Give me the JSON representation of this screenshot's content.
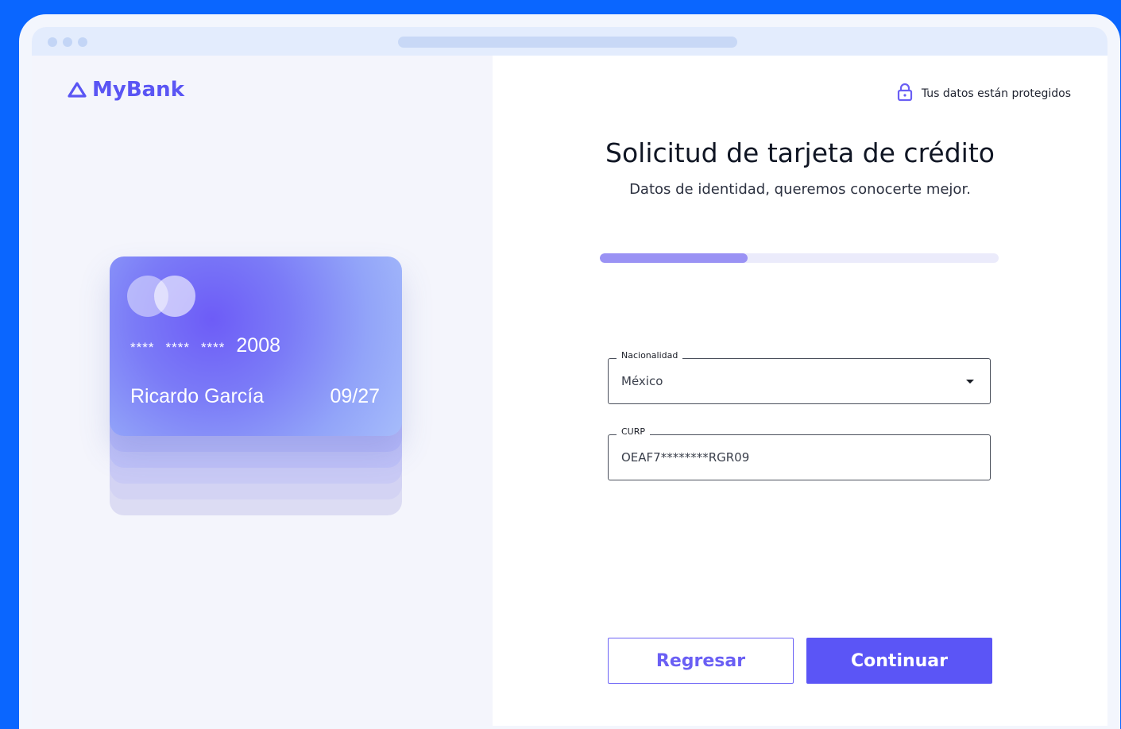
{
  "brand": {
    "name": "MyBank",
    "color": "#5a55f4"
  },
  "card": {
    "masked_groups": [
      "****",
      "****",
      "****"
    ],
    "last_digits": "2008",
    "holder": "Ricardo García",
    "expiry": "09/27"
  },
  "header": {
    "secure_text": "Tus datos están protegidos"
  },
  "form": {
    "title": "Solicitud de tarjeta de crédito",
    "subtitle": "Datos de identidad, queremos conocerte mejor.",
    "progress": 0.37,
    "nationality": {
      "label": "Nacionalidad",
      "value": "México"
    },
    "curp": {
      "label": "CURP",
      "value": "OEAF7********RGR09"
    }
  },
  "actions": {
    "back_label": "Regresar",
    "next_label": "Continuar"
  },
  "colors": {
    "background": "#0a66ff",
    "accent": "#5b55f6",
    "progress_fill": "#9a92f4",
    "progress_track": "#ebebfb"
  },
  "icons": {
    "logo": "triangle-logo-icon",
    "secure": "lock-icon",
    "dropdown": "chevron-down-icon"
  }
}
